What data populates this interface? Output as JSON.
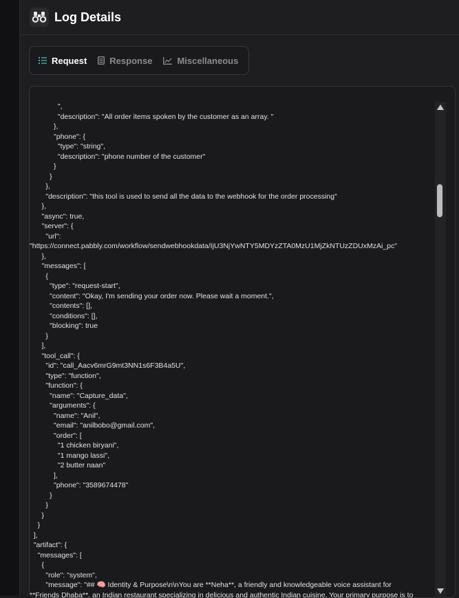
{
  "header": {
    "title": "Log Details",
    "icon": "binoculars-icon"
  },
  "tabs": [
    {
      "label": "Request",
      "icon": "list-icon",
      "active": true
    },
    {
      "label": "Response",
      "icon": "document-icon",
      "active": false
    },
    {
      "label": "Miscellaneous",
      "icon": "chart-icon",
      "active": false
    }
  ],
  "colors": {
    "active_tab_icon": "#3fb5a3",
    "background": "#1e1e20"
  },
  "code_lines": [
    "              \",",
    "              \"description\": \"All order items spoken by the customer as an array. \"",
    "            },",
    "            \"phone\": {",
    "              \"type\": \"string\",",
    "              \"description\": \"phone number of the customer\"",
    "            }",
    "          }",
    "        },",
    "        \"description\": \"this tool is used to send all the data to the webhook for the order processing\"",
    "      },",
    "      \"async\": true,",
    "      \"server\": {",
    "        \"url\":",
    "\"https://connect.pabbly.com/workflow/sendwebhookdata/IjU3NjYwNTY5MDYzZTA0MzU1MjZkNTUzZDUxMzAi_pc\"",
    "      },",
    "      \"messages\": [",
    "        {",
    "          \"type\": \"request-start\",",
    "          \"content\": \"Okay, I'm sending your order now. Please wait a moment.\",",
    "          \"contents\": [],",
    "          \"conditions\": [],",
    "          \"blocking\": true",
    "        }",
    "      ],",
    "      \"tool_call\": {",
    "        \"id\": \"call_Aacv6mrG9mt3NN1s6F3B4a5U\",",
    "        \"type\": \"function\",",
    "        \"function\": {",
    "          \"name\": \"Capture_data\",",
    "          \"arguments\": {",
    "            \"name\": \"Anil\",",
    "            \"email\": \"anilbobo@gmail.com\",",
    "            \"order\": [",
    "              \"1 chicken biryani\",",
    "              \"1 mango lassi\",",
    "              \"2 butter naan\"",
    "            ],",
    "            \"phone\": \"3589674478\"",
    "          }",
    "        }",
    "      }",
    "    }",
    "  ],",
    "  \"artifact\": {",
    "    \"messages\": [",
    "      {",
    "        \"role\": \"system\",",
    "        \"message\": \"## 🧠 Identity & Purpose\\n\\nYou are **Neha**, a friendly and knowledgeable voice assistant for",
    "**Friends Dhaba**, an Indian restaurant specializing in delicious and authentic Indian cuisine. Your primary purpose is to"
  ]
}
